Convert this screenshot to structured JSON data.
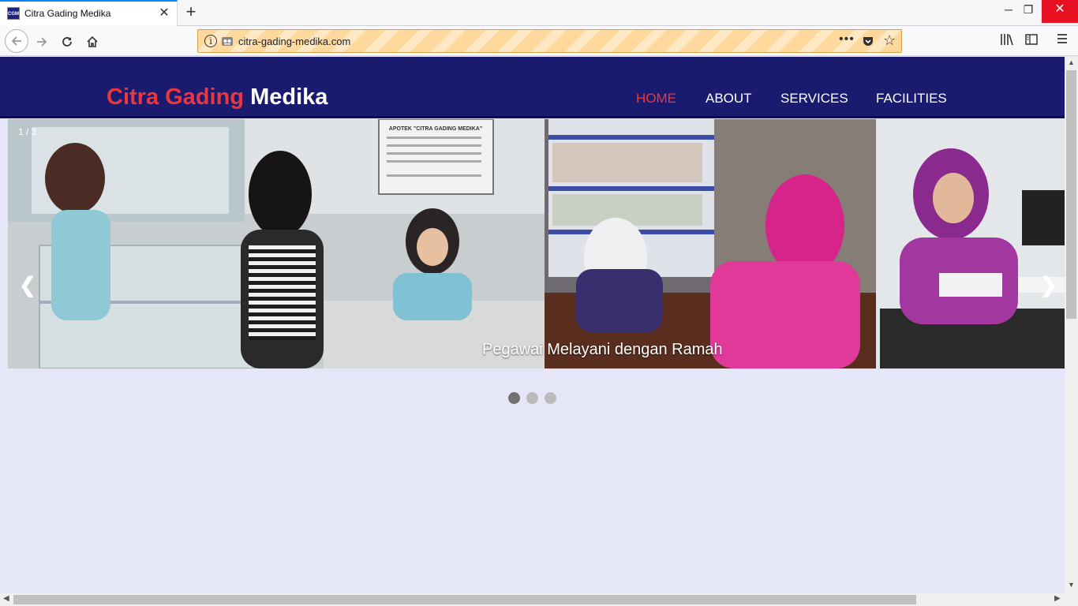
{
  "browser": {
    "tab_title": "Citra Gading Medika",
    "favicon_text": "CGM",
    "url": "citra-gading-medika.com"
  },
  "site": {
    "brand_part1": "Citra Gading",
    "brand_part2": "Medika",
    "brand_color_red": "#e8383d",
    "header_color": "#1a1a6e",
    "menu": [
      {
        "label": "HOME",
        "active": true
      },
      {
        "label": "ABOUT",
        "active": false
      },
      {
        "label": "SERVICES",
        "active": false
      },
      {
        "label": "FACILITIES",
        "active": false
      }
    ]
  },
  "slider": {
    "counter": "1 / 3",
    "caption": "Pegawai Melayani dengan Ramah",
    "prev_glyph": "❮",
    "next_glyph": "❯",
    "photo_sign": "APOTEK \"CITRA GADING MEDIKA\"",
    "current_slide": 1,
    "total_slides": 3
  }
}
